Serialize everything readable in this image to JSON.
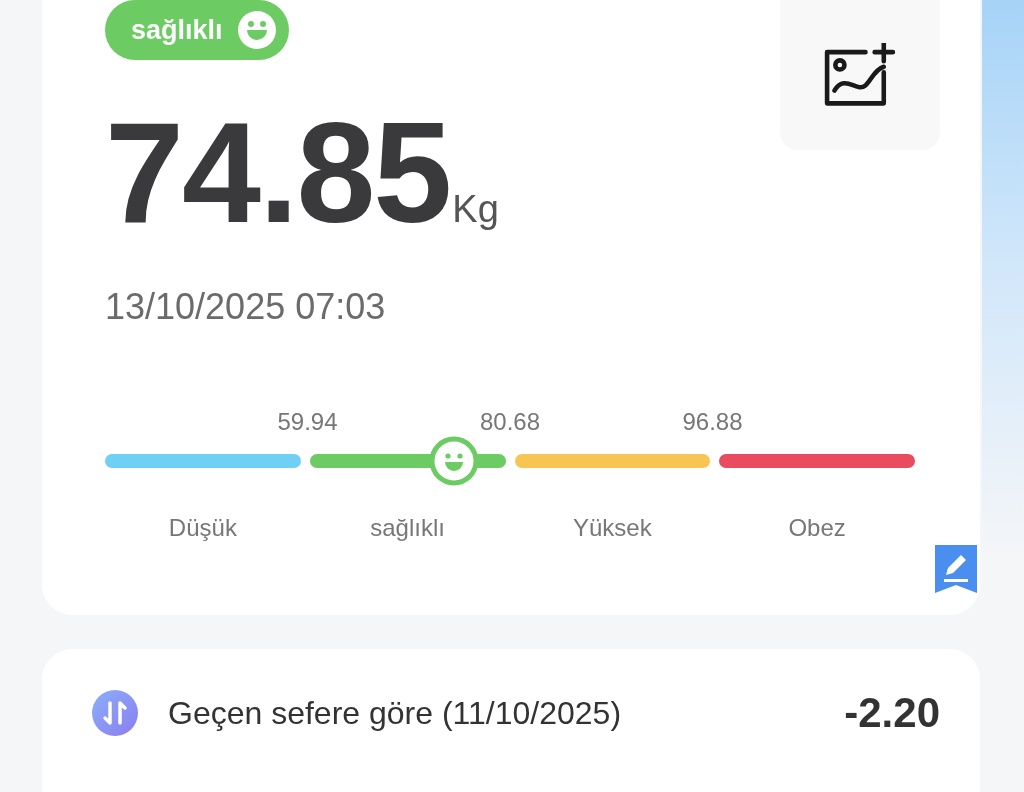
{
  "status_badge": {
    "label": "sağlıklı",
    "color": "#6ccb63"
  },
  "weight": {
    "value": "74.85",
    "unit": "Kg"
  },
  "date": "13/10/2025 07:03",
  "scale": {
    "level": 0.431,
    "ticks": [
      "59.94",
      "80.68",
      "96.88"
    ],
    "segments": [
      {
        "label": "Düşük",
        "color": "#6fcff5"
      },
      {
        "label": "sağlıklı",
        "color": "#6ccb63"
      },
      {
        "label": "Yüksek",
        "color": "#f8c553"
      },
      {
        "label": "Obez",
        "color": "#e94b61"
      }
    ]
  },
  "comparison": {
    "label": "Geçen sefere göre (11/10/2025)",
    "value": "-2.20"
  }
}
